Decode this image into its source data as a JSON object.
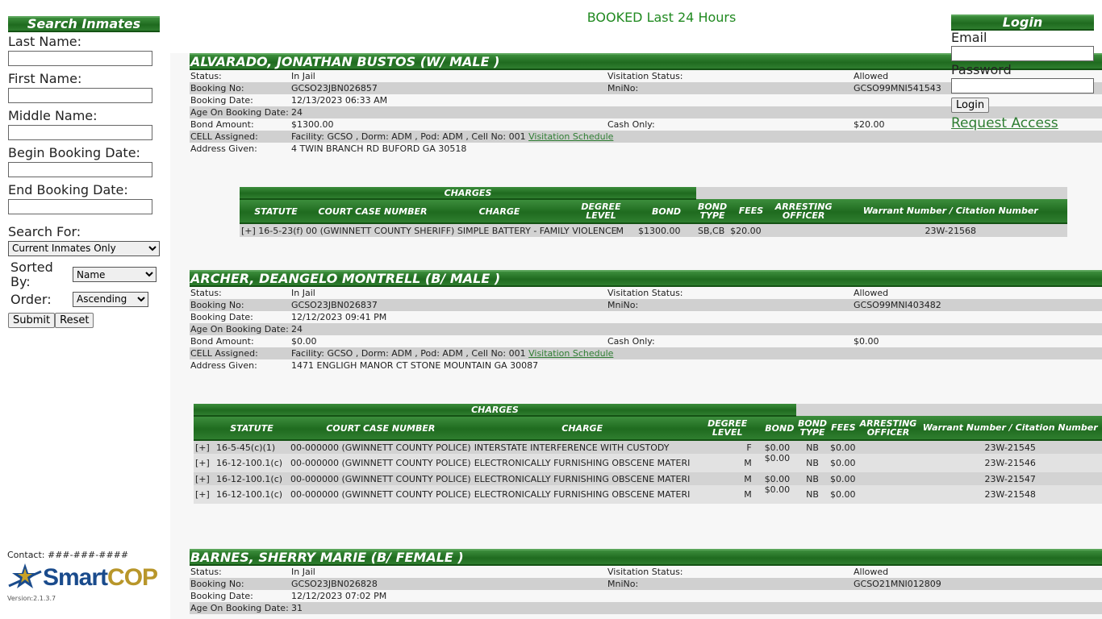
{
  "search": {
    "title": "Search Inmates",
    "last_name_label": "Last Name:",
    "first_name_label": "First Name:",
    "middle_name_label": "Middle Name:",
    "begin_date_label": "Begin Booking Date:",
    "end_date_label": "End Booking Date:",
    "search_for_label": "Search For:",
    "search_for_value": "Current Inmates Only",
    "sorted_by_label": "Sorted By:",
    "sorted_by_value": "Name",
    "order_label": "Order:",
    "order_value": "Ascending",
    "submit": "Submit",
    "reset": "Reset"
  },
  "footer": {
    "contact": "Contact: ###-###-####",
    "logo_text": "SmartCOP",
    "version": "Version:2.1.3.7"
  },
  "page_title": "BOOKED Last 24 Hours",
  "login": {
    "title": "Login",
    "email_label": "Email",
    "password_label": "Password",
    "button": "Login",
    "request_access": "Request Access"
  },
  "labels": {
    "status": "Status:",
    "visitation_status": "Visitation Status:",
    "booking_no": "Booking No:",
    "mnino": "MniNo:",
    "booking_date": "Booking Date:",
    "age": "Age On Booking Date:",
    "bond_amount": "Bond Amount:",
    "cash_only": "Cash Only:",
    "cell": "CELL Assigned:",
    "address": "Address Given:",
    "visitation_link": "Visitation Schedule",
    "charges_caption": "CHARGES",
    "col_statute": "STATUTE",
    "col_case": "COURT CASE NUMBER",
    "col_charge": "CHARGE",
    "col_degree": "DEGREE LEVEL",
    "col_bond": "BOND",
    "col_bond_type": "BOND TYPE",
    "col_fees": "FEES",
    "col_officer": "ARRESTING OFFICER",
    "col_warrant": "Warrant Number / Citation Number"
  },
  "inmates": [
    {
      "name": "ALVARADO, JONATHAN BUSTOS   (W/ MALE )",
      "status": "In Jail",
      "visitation": "Allowed",
      "booking_no": "GCSO23JBN026857",
      "mnino": "GCSO99MNI541543",
      "booking_date": "12/13/2023 06:33 AM",
      "age": "24",
      "bond_amount": "$1300.00",
      "cash_only": "$20.00",
      "cell": "Facility: GCSO , Dorm: ADM , Pod: ADM , Cell No: 001",
      "address": "4 TWIN BRANCH RD BUFORD GA 30518",
      "charges": [
        {
          "text": "[+] 16-5-23(f) 00 (GWINNETT COUNTY SHERIFF) SIMPLE BATTERY - FAMILY VIOLENCE",
          "degree": "M",
          "bond": "$1300.00",
          "bond_type": "SB,CB",
          "fees": "$20.00",
          "warrant": "23W-21568"
        }
      ]
    },
    {
      "name": "ARCHER, DEANGELO MONTRELL   (B/ MALE )",
      "status": "In Jail",
      "visitation": "Allowed",
      "booking_no": "GCSO23JBN026837",
      "mnino": "GCSO99MNI403482",
      "booking_date": "12/12/2023 09:41 PM",
      "age": "24",
      "bond_amount": "$0.00",
      "cash_only": "$0.00",
      "cell": "Facility: GCSO , Dorm: ADM , Pod: ADM , Cell No: 001",
      "address": "1471 ENGLIGH MANOR CT STONE MOUNTAIN GA 30087",
      "charges": [
        {
          "prefix": "[+]",
          "statute": "16-5-45(c)(1)",
          "case": "00-000000 (GWINNETT COUNTY POLICE)",
          "charge": "INTERSTATE INTERFERENCE WITH CUSTODY",
          "degree": "F",
          "bond": "$0.00",
          "bond_type": "NB",
          "fees": "$0.00",
          "warrant": "23W-21545"
        },
        {
          "prefix": "[+]",
          "statute": "16-12-100.1(c)",
          "case": "00-000000 (GWINNETT COUNTY POLICE)",
          "charge": "ELECTRONICALLY FURNISHING OBSCENE MATERI",
          "degree": "M",
          "bond": "$0.00",
          "bond_type": "NB",
          "fees": "$0.00",
          "warrant": "23W-21546"
        },
        {
          "prefix": "[+]",
          "statute": "16-12-100.1(c)",
          "case": "00-000000 (GWINNETT COUNTY POLICE)",
          "charge": "ELECTRONICALLY FURNISHING OBSCENE MATERI",
          "degree": "M",
          "bond": "$0.00",
          "bond_type": "NB",
          "fees": "$0.00",
          "warrant": "23W-21547"
        },
        {
          "prefix": "[+]",
          "statute": "16-12-100.1(c)",
          "case": "00-000000 (GWINNETT COUNTY POLICE)",
          "charge": "ELECTRONICALLY FURNISHING OBSCENE MATERI",
          "degree": "M",
          "bond": "$0.00",
          "bond_type": "NB",
          "fees": "$0.00",
          "warrant": "23W-21548"
        }
      ]
    },
    {
      "name": "BARNES, SHERRY MARIE   (B/ FEMALE )",
      "status": "In Jail",
      "visitation": "Allowed",
      "booking_no": "GCSO23JBN026828",
      "mnino": "GCSO21MNI012809",
      "booking_date": "12/12/2023 07:02 PM",
      "age": "31"
    }
  ],
  "colors": {
    "green": "#1f6b1f",
    "link": "#2e7d32",
    "row_alt": "#d0d0d0"
  }
}
